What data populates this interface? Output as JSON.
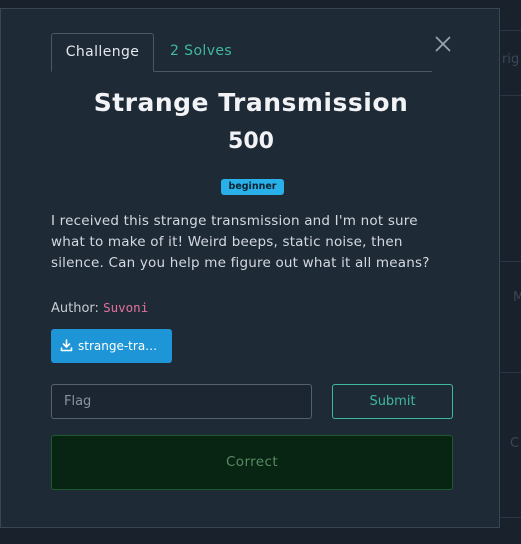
{
  "background": {
    "peek_texts": [
      "rig",
      "M",
      "C"
    ]
  },
  "modal": {
    "tabs": [
      {
        "label": "Challenge"
      },
      {
        "label": "2 Solves"
      }
    ],
    "title": "Strange Transmission",
    "points": "500",
    "tag": "beginner",
    "description": "I received this strange transmission and I'm not sure what to make of it! Weird beeps, static noise, then silence. Can you help me figure out what it all means?",
    "author_label": "Author:",
    "author_name": "Suvoni",
    "download_label": "strange-tra…",
    "flag_placeholder": "Flag",
    "flag_value": "",
    "submit_label": "Submit",
    "result_text": "Correct"
  },
  "colors": {
    "accent_teal": "#3fb8a0",
    "tag_blue": "#2ab0e8",
    "download_blue": "#1e95d6",
    "author_pink": "#e3719b",
    "success_bg": "#082413"
  },
  "icons": {
    "close": "close-icon",
    "download": "download-icon"
  }
}
